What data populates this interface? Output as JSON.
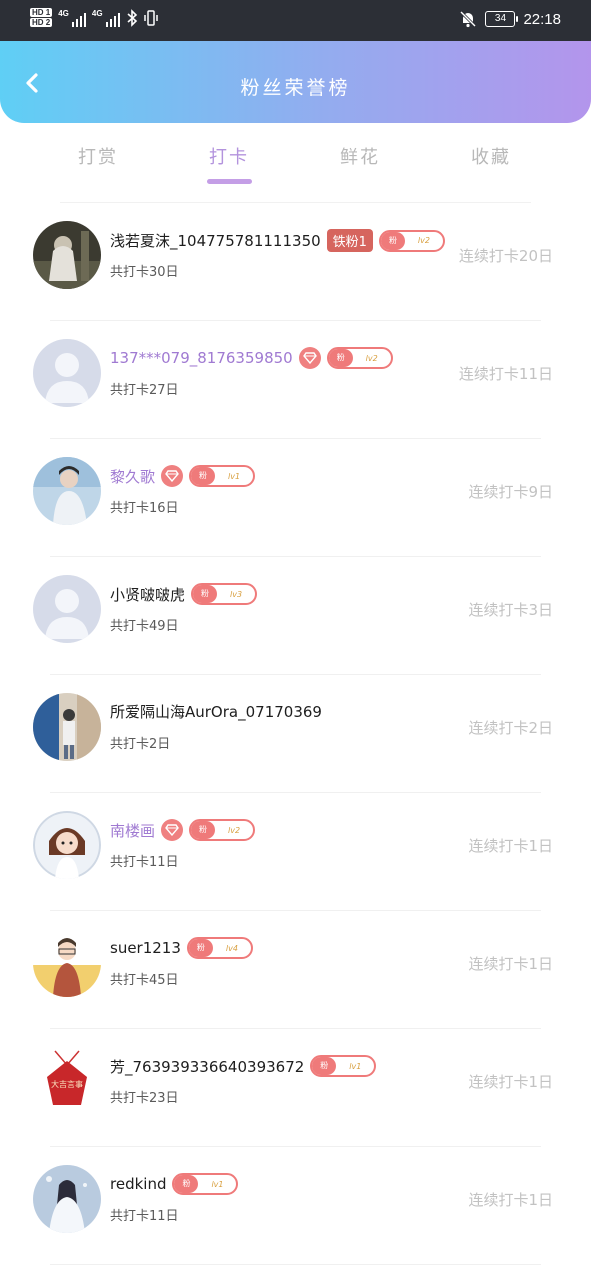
{
  "status_bar": {
    "sim1": "HD 1",
    "sim2": "HD 2",
    "net1": "4G",
    "net2": "4G",
    "battery": "34",
    "time": "22:18"
  },
  "header": {
    "title": "粉丝荣誉榜",
    "gradient_colors": [
      "#5fcff5",
      "#b395ec"
    ]
  },
  "tabs": [
    {
      "label": "打赏"
    },
    {
      "label": "打卡"
    },
    {
      "label": "鲜花"
    },
    {
      "label": "收藏"
    }
  ],
  "active_tab": "打卡",
  "fans": [
    {
      "name": "浅若夏沫_104775781111350",
      "vip": false,
      "iron_badge": "铁粉1",
      "diamond": false,
      "fan_label": "粉",
      "level": "lv2",
      "total": "共打卡30日",
      "streak": "连续打卡20日"
    },
    {
      "name": "137***079_8176359850",
      "vip": true,
      "iron_badge": "",
      "diamond": true,
      "fan_label": "粉",
      "level": "lv2",
      "total": "共打卡27日",
      "streak": "连续打卡11日"
    },
    {
      "name": "黎久歌",
      "vip": true,
      "iron_badge": "",
      "diamond": true,
      "fan_label": "粉",
      "level": "lv1",
      "total": "共打卡16日",
      "streak": "连续打卡9日"
    },
    {
      "name": "小贤啵啵虎",
      "vip": false,
      "iron_badge": "",
      "diamond": false,
      "fan_label": "粉",
      "level": "lv3",
      "total": "共打卡49日",
      "streak": "连续打卡3日"
    },
    {
      "name": "所爱隔山海AurOra_07170369",
      "vip": false,
      "iron_badge": "",
      "diamond": false,
      "fan_label": "",
      "level": "",
      "total": "共打卡2日",
      "streak": "连续打卡2日"
    },
    {
      "name": "南楼画",
      "vip": true,
      "iron_badge": "",
      "diamond": true,
      "fan_label": "粉",
      "level": "lv2",
      "total": "共打卡11日",
      "streak": "连续打卡1日"
    },
    {
      "name": "suer1213",
      "vip": false,
      "iron_badge": "",
      "diamond": false,
      "fan_label": "粉",
      "level": "lv4",
      "total": "共打卡45日",
      "streak": "连续打卡1日"
    },
    {
      "name": "芳_763939336640393672",
      "vip": false,
      "iron_badge": "",
      "diamond": false,
      "fan_label": "粉",
      "level": "lv1",
      "total": "共打卡23日",
      "streak": "连续打卡1日"
    },
    {
      "name": "redkind",
      "vip": false,
      "iron_badge": "",
      "diamond": false,
      "fan_label": "粉",
      "level": "lv1",
      "total": "共打卡11日",
      "streak": "连续打卡1日"
    }
  ],
  "avatar_art": {
    "tag_text": "大吉言事"
  }
}
